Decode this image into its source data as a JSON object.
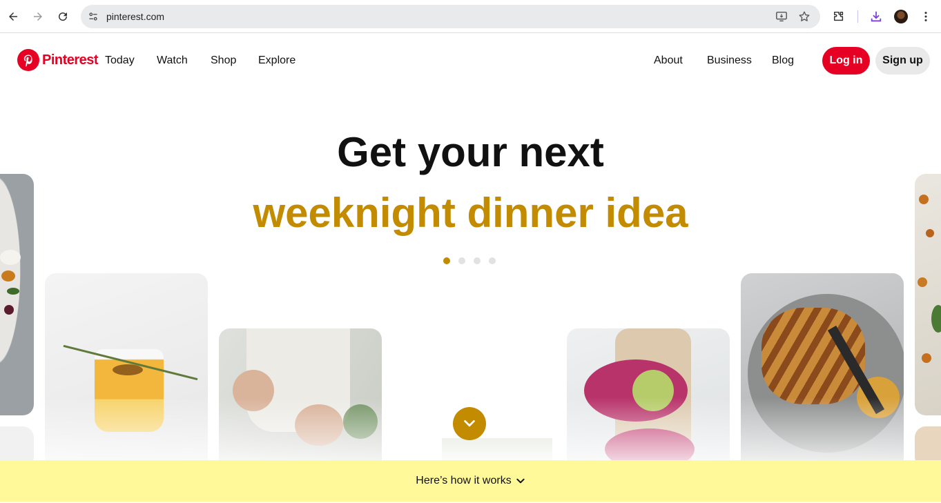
{
  "browser": {
    "url": "pinterest.com",
    "icons": [
      "back-arrow-icon",
      "forward-arrow-icon",
      "reload-icon",
      "site-info-icon",
      "install-app-icon",
      "bookmark-star-icon",
      "extensions-icon",
      "download-icon",
      "profile-avatar",
      "more-menu-icon"
    ]
  },
  "header": {
    "brand": "Pinterest",
    "nav_left": [
      "Today",
      "Watch",
      "Shop",
      "Explore"
    ],
    "nav_right": [
      "About",
      "Business",
      "Blog"
    ],
    "login_label": "Log in",
    "signup_label": "Sign up"
  },
  "hero": {
    "line1": "Get your next",
    "line2": "weeknight dinner idea",
    "slide_count": 4,
    "active_slide": 1
  },
  "colors": {
    "brand_red": "#e60023",
    "accent_gold": "#c28b00",
    "bottom_bar": "#fff99a"
  },
  "footer_bar": {
    "label": "Here’s how it works"
  }
}
